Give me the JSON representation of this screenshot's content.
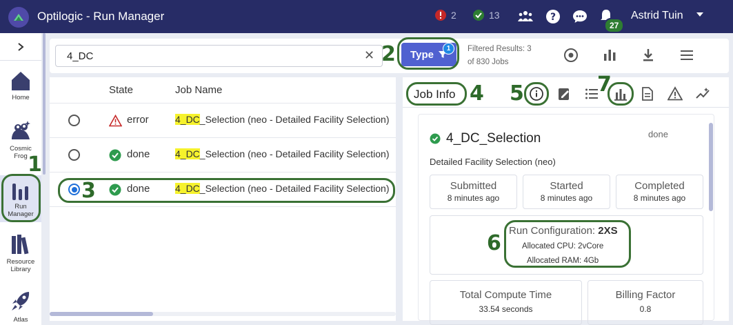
{
  "app": {
    "title": "Optilogic - Run Manager"
  },
  "topbar": {
    "error_count": "2",
    "done_count": "13",
    "user_name": "Astrid Tuin",
    "notification_count": "27",
    "colors": {
      "bg": "#272c66",
      "error": "#c62828",
      "success": "#2e7d32"
    }
  },
  "sidebar": {
    "items": [
      {
        "label_line1": "Home",
        "label_line2": "",
        "icon": "home-icon"
      },
      {
        "label_line1": "Cosmic",
        "label_line2": "Frog",
        "icon": "cosmic-frog-icon"
      },
      {
        "label_line1": "Run",
        "label_line2": "Manager",
        "icon": "bar-chart-icon"
      },
      {
        "label_line1": "Resource",
        "label_line2": "Library",
        "icon": "books-icon"
      },
      {
        "label_line1": "Atlas",
        "label_line2": "",
        "icon": "rocket-icon"
      }
    ]
  },
  "search": {
    "value": "4_DC",
    "type_label": "Type",
    "type_badge": "1",
    "filtered_line1": "Filtered Results: 3",
    "filtered_line2": "of 830 Jobs"
  },
  "table": {
    "headers": {
      "state": "State",
      "job_name": "Job Name"
    },
    "rows": [
      {
        "state": "error",
        "highlight": "4_DC",
        "rest": "_Selection (neo - Detailed Facility Selection)",
        "selected": false
      },
      {
        "state": "done",
        "highlight": "4_DC",
        "rest": "_Selection (neo - Detailed Facility Selection)",
        "selected": false
      },
      {
        "state": "done",
        "highlight": "4_DC",
        "rest": "_Selection (neo - Detailed Facility Selection)",
        "selected": true
      }
    ]
  },
  "details": {
    "tab_label": "Job Info",
    "job_title": "4_DC_Selection",
    "job_status": "done",
    "job_subtitle": "Detailed Facility Selection (neo)",
    "stats": [
      {
        "label": "Submitted",
        "value": "8 minutes ago"
      },
      {
        "label": "Started",
        "value": "8 minutes ago"
      },
      {
        "label": "Completed",
        "value": "8 minutes ago"
      }
    ],
    "run_config_label": "Run Configuration: ",
    "run_config_value": "2XS",
    "cpu": "Allocated CPU: 2vCore",
    "ram": "Allocated RAM: 4Gb",
    "compute_label": "Total Compute Time",
    "compute_value": "33.54 seconds",
    "billing_label": "Billing Factor",
    "billing_value": "0.8"
  },
  "annotations": {
    "n1": "1",
    "n2": "2",
    "n3": "3",
    "n4": "4",
    "n5": "5",
    "n6": "6",
    "n7": "7"
  }
}
